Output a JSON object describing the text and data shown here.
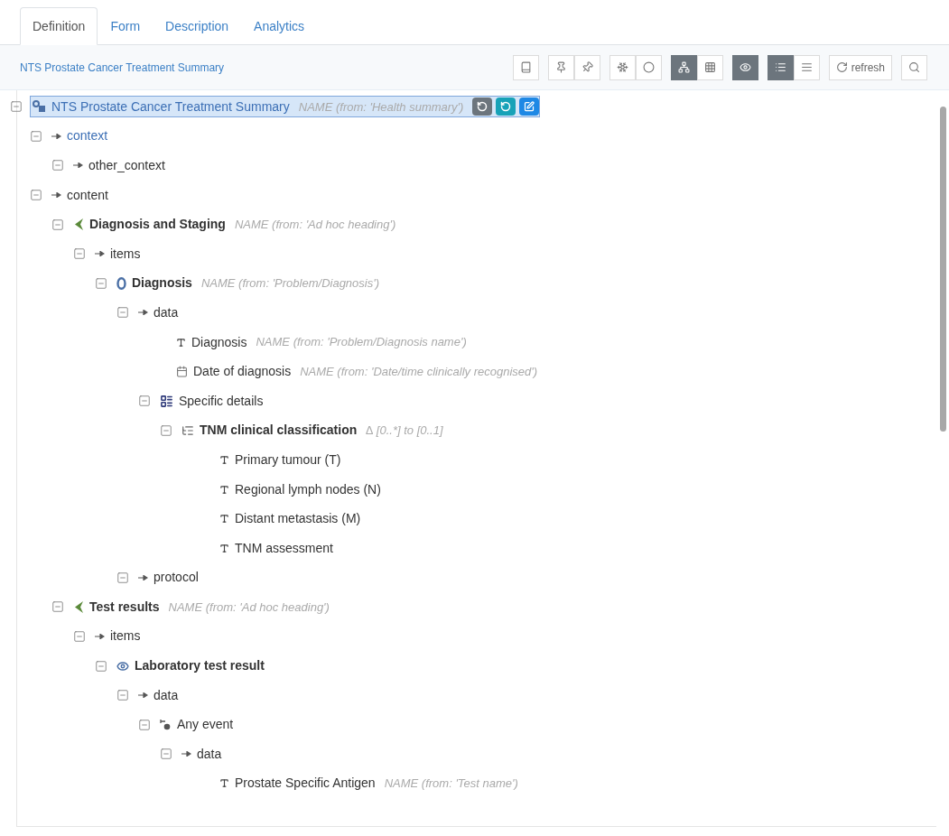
{
  "tabs": [
    {
      "label": "Definition",
      "selected": true
    },
    {
      "label": "Form",
      "selected": false
    },
    {
      "label": "Description",
      "selected": false
    },
    {
      "label": "Analytics",
      "selected": false
    }
  ],
  "toolbar": {
    "title": "NTS Prostate Cancer Treatment Summary",
    "groups": [
      [
        {
          "kind": "book",
          "selected": false
        }
      ],
      [
        {
          "kind": "pin",
          "selected": false
        },
        {
          "kind": "pin-alt",
          "selected": false
        }
      ],
      [
        {
          "kind": "snowflake",
          "selected": false
        },
        {
          "kind": "circle",
          "selected": false
        }
      ],
      [
        {
          "kind": "tree",
          "selected": true
        },
        {
          "kind": "grid",
          "selected": false
        }
      ],
      [
        {
          "kind": "eye",
          "selected": true
        }
      ],
      [
        {
          "kind": "list",
          "selected": true
        },
        {
          "kind": "lines",
          "selected": false
        }
      ],
      [
        {
          "kind": "refresh",
          "selected": false,
          "label": "refresh"
        }
      ],
      [
        {
          "kind": "search",
          "selected": false
        }
      ]
    ]
  },
  "tree": {
    "root": {
      "kind": "root",
      "label": "NTS Prostate Cancer Treatment Summary",
      "annotation": "NAME (from: 'Health summary')",
      "selected": true,
      "expanded": true,
      "actions": [
        {
          "kind": "undo-gray"
        },
        {
          "kind": "undo-teal"
        },
        {
          "kind": "edit"
        }
      ],
      "children": [
        {
          "kind": "attribute",
          "label": "context",
          "linked": true,
          "expanded": true,
          "children": [
            {
              "kind": "attribute",
              "label": "other_context",
              "linked": false,
              "expanded": true
            }
          ]
        },
        {
          "kind": "attribute",
          "label": "content",
          "linked": false,
          "expanded": true,
          "children": [
            {
              "kind": "section",
              "label": "Diagnosis and Staging",
              "annotation": "NAME (from: 'Ad hoc heading')",
              "expanded": true,
              "children": [
                {
                  "kind": "attribute",
                  "label": "items",
                  "linked": false,
                  "expanded": true,
                  "children": [
                    {
                      "kind": "evaluation",
                      "label": "Diagnosis",
                      "annotation": "NAME (from: 'Problem/Diagnosis')",
                      "expanded": true,
                      "children": [
                        {
                          "kind": "attribute",
                          "label": "data",
                          "linked": false,
                          "expanded": true,
                          "children": [
                            {
                              "kind": "text",
                              "label": "Diagnosis",
                              "annotation": "NAME (from: 'Problem/Diagnosis name')"
                            },
                            {
                              "kind": "date",
                              "label": "Date of diagnosis",
                              "annotation": "NAME (from: 'Date/time clinically recognised')"
                            },
                            {
                              "kind": "slot",
                              "label": "Specific details",
                              "expanded": true,
                              "children": [
                                {
                                  "kind": "cluster",
                                  "label": "TNM clinical classification",
                                  "annotation": "∆ [0..*] to [0..1]",
                                  "expanded": true,
                                  "children": [
                                    {
                                      "kind": "text",
                                      "label": "Primary tumour (T)"
                                    },
                                    {
                                      "kind": "text",
                                      "label": "Regional lymph nodes (N)"
                                    },
                                    {
                                      "kind": "text",
                                      "label": "Distant metastasis (M)"
                                    },
                                    {
                                      "kind": "text",
                                      "label": "TNM assessment"
                                    }
                                  ]
                                }
                              ]
                            }
                          ]
                        },
                        {
                          "kind": "attribute",
                          "label": "protocol",
                          "linked": false,
                          "expanded": true
                        }
                      ]
                    }
                  ]
                }
              ]
            },
            {
              "kind": "section",
              "label": "Test results",
              "annotation": "NAME (from: 'Ad hoc heading')",
              "expanded": true,
              "children": [
                {
                  "kind": "attribute",
                  "label": "items",
                  "linked": false,
                  "expanded": true,
                  "children": [
                    {
                      "kind": "observation",
                      "label": "Laboratory test result",
                      "expanded": true,
                      "children": [
                        {
                          "kind": "attribute",
                          "label": "data",
                          "linked": false,
                          "expanded": true,
                          "children": [
                            {
                              "kind": "event",
                              "label": "Any event",
                              "expanded": true,
                              "children": [
                                {
                                  "kind": "attribute",
                                  "label": "data",
                                  "linked": false,
                                  "expanded": true,
                                  "children": [
                                    {
                                      "kind": "text",
                                      "label": "Prostate Specific Antigen",
                                      "annotation": "NAME (from: 'Test name')"
                                    }
                                  ]
                                }
                              ]
                            }
                          ]
                        }
                      ]
                    }
                  ]
                }
              ]
            }
          ]
        }
      ]
    }
  }
}
